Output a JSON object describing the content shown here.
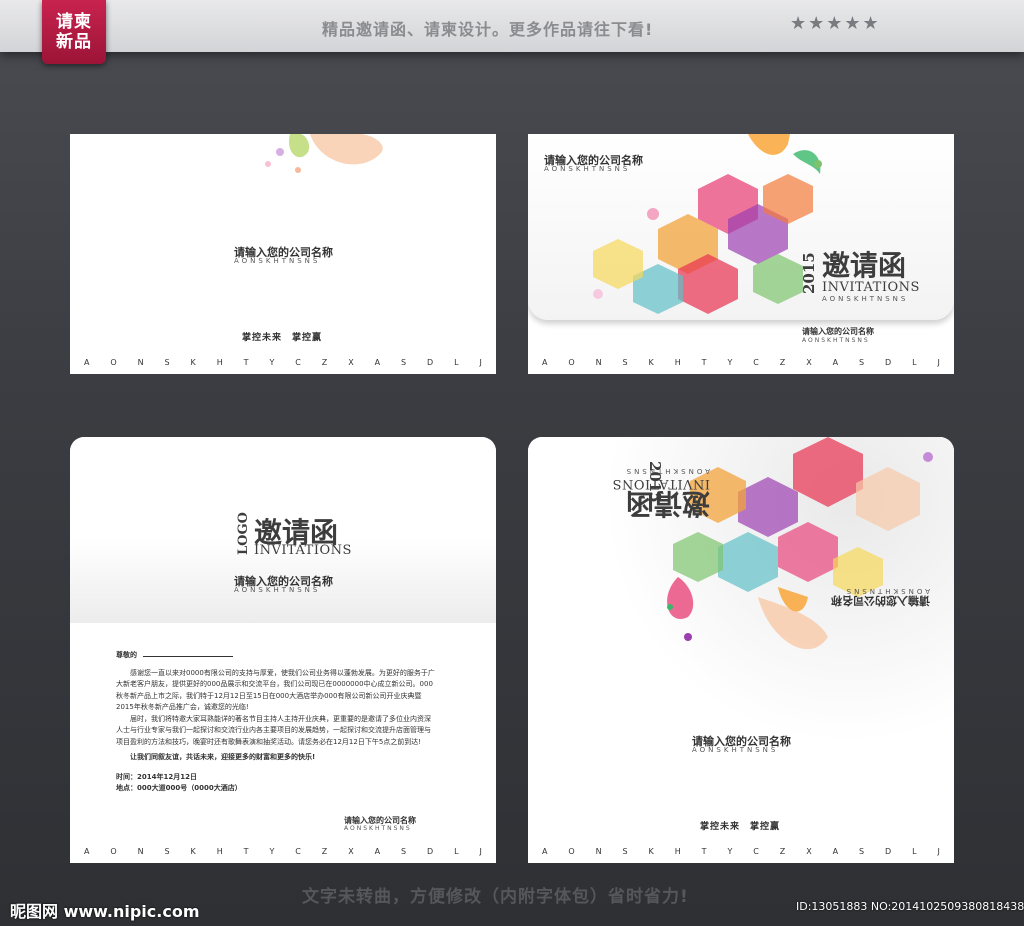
{
  "header": {
    "badge_line1": "请柬",
    "badge_line2": "新品",
    "slogan": "精品邀请函、请柬设计。更多作品请往下看!",
    "stars": "★★★★★"
  },
  "footer": {
    "slogan": "文字未转曲，方便修改（内附字体包）省时省力!",
    "watermark_left": "昵图网 www.nipic.com",
    "watermark_right": "ID:13051883 NO:20141025093808184388"
  },
  "alphabet": [
    "A",
    "O",
    "N",
    "S",
    "K",
    "H",
    "T",
    "Y",
    "C",
    "Z",
    "X",
    "A",
    "S",
    "D",
    "L",
    "J"
  ],
  "card1": {
    "company": "请输入您的公司名称",
    "company_en": "AONSKHTNSNS",
    "slogan": "掌控未来　掌控赢"
  },
  "card2": {
    "company": "请输入您的公司名称",
    "company_en": "AONSKHTNSNS",
    "year": "2015",
    "title_cn": "邀请函",
    "title_en": "INVITATIONS",
    "title_en_sub": "AONSKHTNSNS",
    "company_small": "请输入您的公司名称",
    "company_small_en": "AONSKHTNSNS"
  },
  "card3": {
    "logo": "LOGO",
    "title_cn": "邀请函",
    "title_en": "INVITATIONS",
    "company": "请输入您的公司名称",
    "company_en": "AONSKHTNSNS",
    "greeting": "尊敬的",
    "para1": "感谢您一直以来对0000有限公司的支持与厚爱，使我们公司业务得以蓬勃发展。为更好的服务于广大新老客户朋友，提供更好的000品展示和交流平台，我们公司现已在0000000中心成立新公司。000秋冬新产品上市之际，我们特于12月12日至15日在000大酒店举办000有限公司新公司开业庆典暨2015年秋冬新产品推广会，诚邀您的光临!",
    "para2": "届时，我们将特邀大家耳熟能详的著名节目主持人主持开业庆典，更重要的是邀请了多位业内资深人士与行业专家与我们一起探讨和交流行业内各主要项目的发展趋势，一起探讨和交流提升店面管理与项目盈利的方法和技巧，晚宴时还有歌舞表演和抽奖活动。请您务必在12月12日下午5点之前到达!",
    "closing": "让我们同叙友谊，共话未来，迎接更多的财富和更多的快乐!",
    "time": "时间：2014年12月12日",
    "place": "地点：000大道000号（0000大酒店）",
    "sign_company": "请输入您的公司名称",
    "sign_company_en": "AONSKHTNSNS"
  },
  "card4": {
    "title_cn": "邀请函",
    "title_en": "INVITATIONS",
    "title_en_sub": "AONSKHTNSNS",
    "year": "2015",
    "company_flipped": "请输入您的公司名称",
    "company_flipped_en": "AONSKHTNSNS",
    "company": "请输入您的公司名称",
    "company_en": "AONSKHTNSNS",
    "slogan": "掌控未来　掌控赢"
  }
}
